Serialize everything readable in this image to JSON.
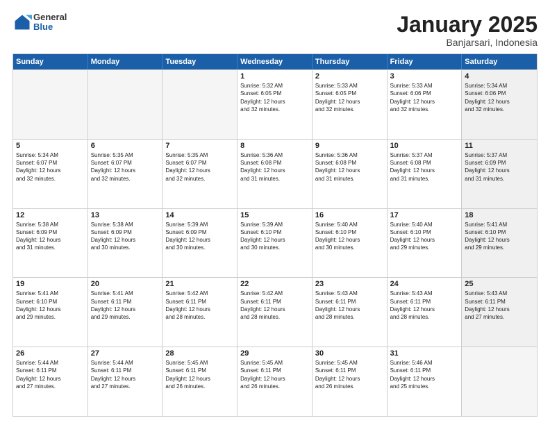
{
  "header": {
    "logo_general": "General",
    "logo_blue": "Blue",
    "title": "January 2025",
    "location": "Banjarsari, Indonesia"
  },
  "weekdays": [
    "Sunday",
    "Monday",
    "Tuesday",
    "Wednesday",
    "Thursday",
    "Friday",
    "Saturday"
  ],
  "weeks": [
    [
      {
        "day": "",
        "info": "",
        "empty": true
      },
      {
        "day": "",
        "info": "",
        "empty": true
      },
      {
        "day": "",
        "info": "",
        "empty": true
      },
      {
        "day": "1",
        "info": "Sunrise: 5:32 AM\nSunset: 6:05 PM\nDaylight: 12 hours\nand 32 minutes.",
        "empty": false
      },
      {
        "day": "2",
        "info": "Sunrise: 5:33 AM\nSunset: 6:05 PM\nDaylight: 12 hours\nand 32 minutes.",
        "empty": false
      },
      {
        "day": "3",
        "info": "Sunrise: 5:33 AM\nSunset: 6:06 PM\nDaylight: 12 hours\nand 32 minutes.",
        "empty": false
      },
      {
        "day": "4",
        "info": "Sunrise: 5:34 AM\nSunset: 6:06 PM\nDaylight: 12 hours\nand 32 minutes.",
        "empty": false
      }
    ],
    [
      {
        "day": "5",
        "info": "Sunrise: 5:34 AM\nSunset: 6:07 PM\nDaylight: 12 hours\nand 32 minutes.",
        "empty": false
      },
      {
        "day": "6",
        "info": "Sunrise: 5:35 AM\nSunset: 6:07 PM\nDaylight: 12 hours\nand 32 minutes.",
        "empty": false
      },
      {
        "day": "7",
        "info": "Sunrise: 5:35 AM\nSunset: 6:07 PM\nDaylight: 12 hours\nand 32 minutes.",
        "empty": false
      },
      {
        "day": "8",
        "info": "Sunrise: 5:36 AM\nSunset: 6:08 PM\nDaylight: 12 hours\nand 31 minutes.",
        "empty": false
      },
      {
        "day": "9",
        "info": "Sunrise: 5:36 AM\nSunset: 6:08 PM\nDaylight: 12 hours\nand 31 minutes.",
        "empty": false
      },
      {
        "day": "10",
        "info": "Sunrise: 5:37 AM\nSunset: 6:08 PM\nDaylight: 12 hours\nand 31 minutes.",
        "empty": false
      },
      {
        "day": "11",
        "info": "Sunrise: 5:37 AM\nSunset: 6:09 PM\nDaylight: 12 hours\nand 31 minutes.",
        "empty": false
      }
    ],
    [
      {
        "day": "12",
        "info": "Sunrise: 5:38 AM\nSunset: 6:09 PM\nDaylight: 12 hours\nand 31 minutes.",
        "empty": false
      },
      {
        "day": "13",
        "info": "Sunrise: 5:38 AM\nSunset: 6:09 PM\nDaylight: 12 hours\nand 30 minutes.",
        "empty": false
      },
      {
        "day": "14",
        "info": "Sunrise: 5:39 AM\nSunset: 6:09 PM\nDaylight: 12 hours\nand 30 minutes.",
        "empty": false
      },
      {
        "day": "15",
        "info": "Sunrise: 5:39 AM\nSunset: 6:10 PM\nDaylight: 12 hours\nand 30 minutes.",
        "empty": false
      },
      {
        "day": "16",
        "info": "Sunrise: 5:40 AM\nSunset: 6:10 PM\nDaylight: 12 hours\nand 30 minutes.",
        "empty": false
      },
      {
        "day": "17",
        "info": "Sunrise: 5:40 AM\nSunset: 6:10 PM\nDaylight: 12 hours\nand 29 minutes.",
        "empty": false
      },
      {
        "day": "18",
        "info": "Sunrise: 5:41 AM\nSunset: 6:10 PM\nDaylight: 12 hours\nand 29 minutes.",
        "empty": false
      }
    ],
    [
      {
        "day": "19",
        "info": "Sunrise: 5:41 AM\nSunset: 6:10 PM\nDaylight: 12 hours\nand 29 minutes.",
        "empty": false
      },
      {
        "day": "20",
        "info": "Sunrise: 5:41 AM\nSunset: 6:11 PM\nDaylight: 12 hours\nand 29 minutes.",
        "empty": false
      },
      {
        "day": "21",
        "info": "Sunrise: 5:42 AM\nSunset: 6:11 PM\nDaylight: 12 hours\nand 28 minutes.",
        "empty": false
      },
      {
        "day": "22",
        "info": "Sunrise: 5:42 AM\nSunset: 6:11 PM\nDaylight: 12 hours\nand 28 minutes.",
        "empty": false
      },
      {
        "day": "23",
        "info": "Sunrise: 5:43 AM\nSunset: 6:11 PM\nDaylight: 12 hours\nand 28 minutes.",
        "empty": false
      },
      {
        "day": "24",
        "info": "Sunrise: 5:43 AM\nSunset: 6:11 PM\nDaylight: 12 hours\nand 28 minutes.",
        "empty": false
      },
      {
        "day": "25",
        "info": "Sunrise: 5:43 AM\nSunset: 6:11 PM\nDaylight: 12 hours\nand 27 minutes.",
        "empty": false
      }
    ],
    [
      {
        "day": "26",
        "info": "Sunrise: 5:44 AM\nSunset: 6:11 PM\nDaylight: 12 hours\nand 27 minutes.",
        "empty": false
      },
      {
        "day": "27",
        "info": "Sunrise: 5:44 AM\nSunset: 6:11 PM\nDaylight: 12 hours\nand 27 minutes.",
        "empty": false
      },
      {
        "day": "28",
        "info": "Sunrise: 5:45 AM\nSunset: 6:11 PM\nDaylight: 12 hours\nand 26 minutes.",
        "empty": false
      },
      {
        "day": "29",
        "info": "Sunrise: 5:45 AM\nSunset: 6:11 PM\nDaylight: 12 hours\nand 26 minutes.",
        "empty": false
      },
      {
        "day": "30",
        "info": "Sunrise: 5:45 AM\nSunset: 6:11 PM\nDaylight: 12 hours\nand 26 minutes.",
        "empty": false
      },
      {
        "day": "31",
        "info": "Sunrise: 5:46 AM\nSunset: 6:11 PM\nDaylight: 12 hours\nand 25 minutes.",
        "empty": false
      },
      {
        "day": "",
        "info": "",
        "empty": true
      }
    ]
  ]
}
